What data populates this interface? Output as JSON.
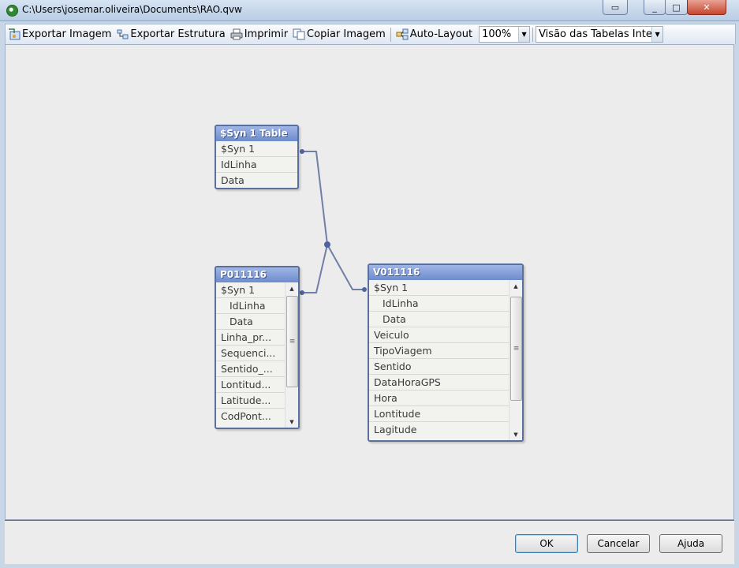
{
  "window": {
    "title": "C:\\Users\\josemar.oliveira\\Documents\\RAO.qvw",
    "buttons": [
      "▭",
      "_",
      "□",
      "✕"
    ]
  },
  "toolbar": {
    "export_image": "Exportar Imagem",
    "export_structure": "Exportar Estrutura",
    "print": "Imprimir",
    "copy_image": "Copiar Imagem",
    "auto_layout": "Auto-Layout",
    "zoom": "100%",
    "view": "Visão das Tabelas Interna"
  },
  "tables": [
    {
      "name": "$Syn 1 Table",
      "fields": [
        {
          "label": "$Syn 1",
          "indent": false
        },
        {
          "label": "IdLinha",
          "indent": false
        },
        {
          "label": "Data",
          "indent": false
        }
      ],
      "scrollbar": false
    },
    {
      "name": "P011116",
      "fields": [
        {
          "label": "$Syn 1",
          "indent": false
        },
        {
          "label": "IdLinha",
          "indent": true
        },
        {
          "label": "Data",
          "indent": true
        },
        {
          "label": "Linha_pr...",
          "indent": false
        },
        {
          "label": "Sequenci...",
          "indent": false
        },
        {
          "label": "Sentido_...",
          "indent": false
        },
        {
          "label": "Lontitud...",
          "indent": false
        },
        {
          "label": "Latitude...",
          "indent": false
        },
        {
          "label": "CodPont...",
          "indent": false
        }
      ],
      "scrollbar": true
    },
    {
      "name": "V011116",
      "fields": [
        {
          "label": "$Syn 1",
          "indent": false
        },
        {
          "label": "IdLinha",
          "indent": true
        },
        {
          "label": "Data",
          "indent": true
        },
        {
          "label": "Veiculo",
          "indent": false
        },
        {
          "label": "TipoViagem",
          "indent": false
        },
        {
          "label": "Sentido",
          "indent": false
        },
        {
          "label": "DataHoraGPS",
          "indent": false
        },
        {
          "label": "Hora",
          "indent": false
        },
        {
          "label": "Lontitude",
          "indent": false
        },
        {
          "label": "Lagitude",
          "indent": false
        }
      ],
      "scrollbar": true
    }
  ],
  "footer": {
    "ok": "OK",
    "cancel": "Cancelar",
    "help": "Ajuda"
  },
  "colors": {
    "table_header": "#7b96d4",
    "link_line": "#6f7fa6",
    "canvas": "#ececec"
  }
}
